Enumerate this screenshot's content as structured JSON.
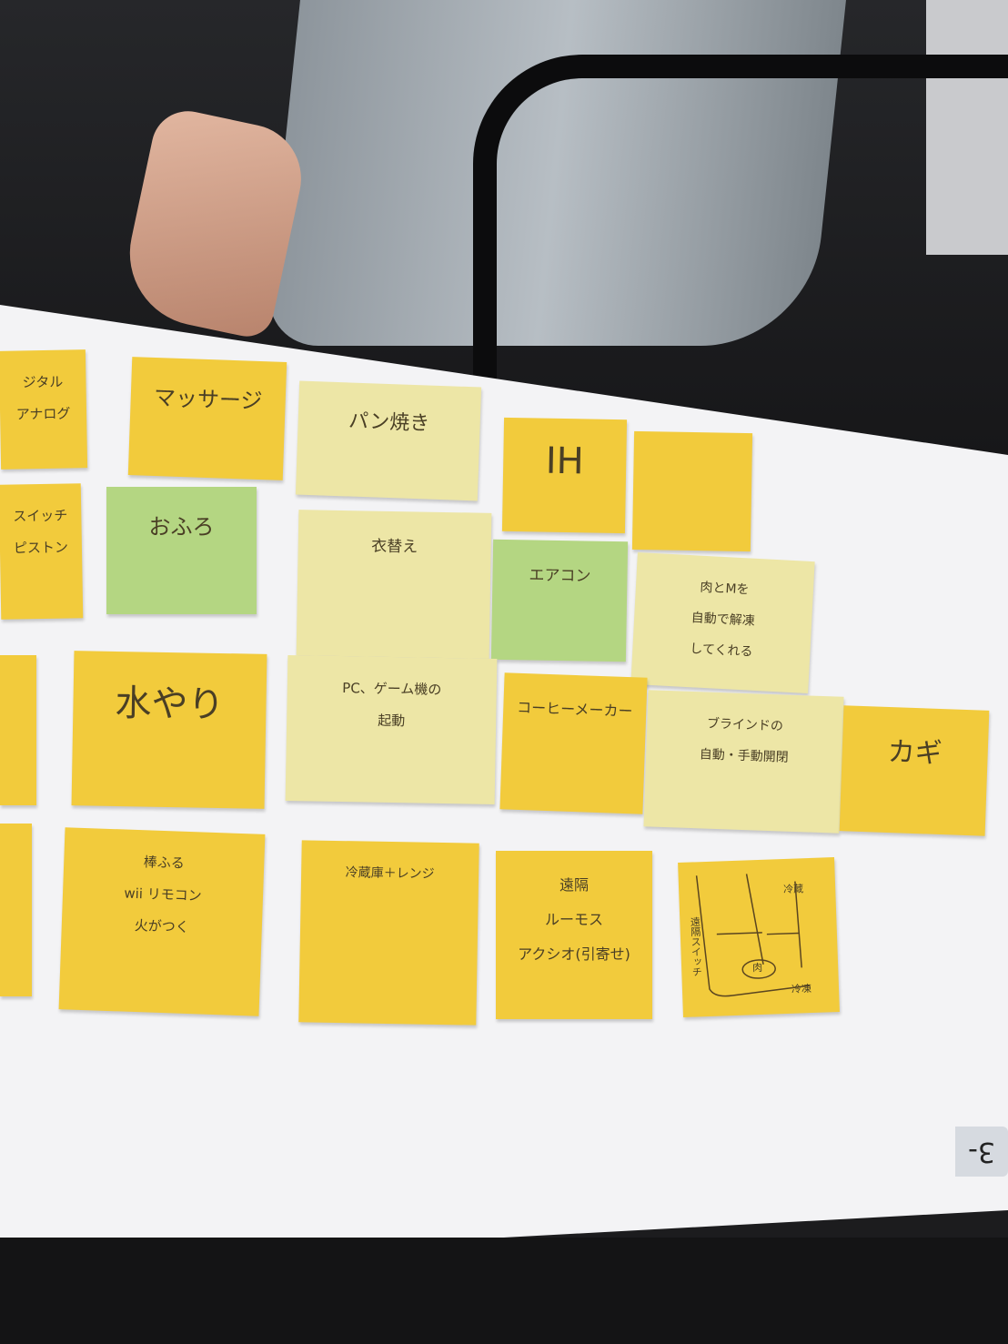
{
  "colors": {
    "yellow": "#f2cb3c",
    "pale": "#ede6a6",
    "green": "#b4d682"
  },
  "table_tag": "3-",
  "notes": [
    {
      "color": "yellow",
      "lines": [
        "ジタル",
        "アナログ"
      ]
    },
    {
      "color": "yellow",
      "lines": [
        "スイッチ",
        "ピストン"
      ]
    },
    {
      "color": "yellow",
      "lines": [
        "マッサージ"
      ]
    },
    {
      "color": "pale",
      "lines": [
        "パン焼き"
      ]
    },
    {
      "color": "yellow",
      "lines": [
        "IH"
      ]
    },
    {
      "color": "yellow",
      "lines": []
    },
    {
      "color": "green",
      "lines": [
        "おふろ"
      ]
    },
    {
      "color": "pale",
      "lines": [
        "衣替え"
      ]
    },
    {
      "color": "green",
      "lines": [
        "エアコン"
      ]
    },
    {
      "color": "pale",
      "lines": [
        "肉とMを",
        "自動で解凍",
        "してくれる"
      ]
    },
    {
      "color": "yellow",
      "lines": []
    },
    {
      "color": "yellow",
      "lines": [
        "水やり"
      ]
    },
    {
      "color": "pale",
      "lines": [
        "PC、ゲーム機の",
        "起動"
      ]
    },
    {
      "color": "yellow",
      "lines": [
        "コーヒーメーカー"
      ]
    },
    {
      "color": "pale",
      "lines": [
        "ブラインドの",
        "自動・手動開閉"
      ]
    },
    {
      "color": "yellow",
      "lines": [
        "カギ"
      ]
    },
    {
      "color": "yellow",
      "lines": []
    },
    {
      "color": "yellow",
      "lines": [
        "棒ふる",
        "wii リモコン",
        "火がつく"
      ]
    },
    {
      "color": "yellow",
      "lines": [
        "冷蔵庫＋レンジ"
      ]
    },
    {
      "color": "yellow",
      "lines": [
        "遠隔",
        "ルーモス",
        "アクシオ(引寄せ)"
      ]
    },
    {
      "color": "yellow",
      "lines": [
        "遠隔スイッチ",
        "冷蔵",
        "肉",
        "冷凍"
      ],
      "sketch": true
    }
  ]
}
